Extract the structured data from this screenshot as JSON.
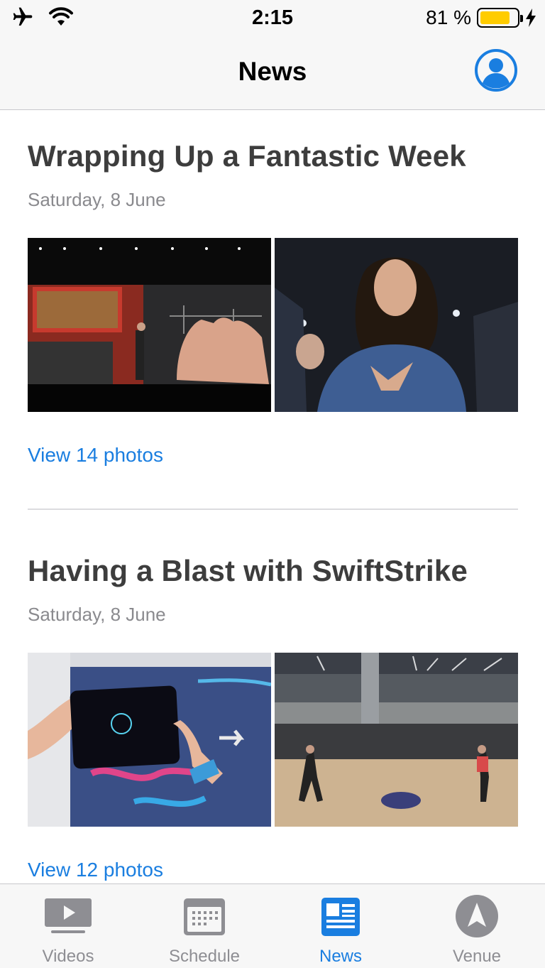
{
  "status_bar": {
    "time": "2:15",
    "battery_percent": "81 %",
    "battery_level": 0.81,
    "icons": [
      "airplane-icon",
      "wifi-icon",
      "battery-icon",
      "charging-bolt-icon"
    ]
  },
  "nav": {
    "title": "News",
    "profile_icon": "person-circle-icon"
  },
  "articles": [
    {
      "title": "Wrapping Up a Fantastic Week",
      "date": "Saturday, 8 June",
      "link": "View 14 photos",
      "photos": [
        "keynote-stage-photo",
        "applauding-attendee-photo"
      ]
    },
    {
      "title": "Having a Blast with SwiftStrike",
      "date": "Saturday, 8 June",
      "link": "View 12 photos",
      "photos": [
        "ipad-game-photo",
        "atrium-game-photo"
      ]
    }
  ],
  "tabs": [
    {
      "label": "Videos",
      "icon": "play-screen-icon"
    },
    {
      "label": "Schedule",
      "icon": "calendar-icon"
    },
    {
      "label": "News",
      "icon": "newspaper-icon"
    },
    {
      "label": "Venue",
      "icon": "location-arrow-icon"
    }
  ],
  "colors": {
    "accent": "#1a7ee0",
    "inactive": "#8e8e93",
    "battery": "#ffcc00"
  }
}
